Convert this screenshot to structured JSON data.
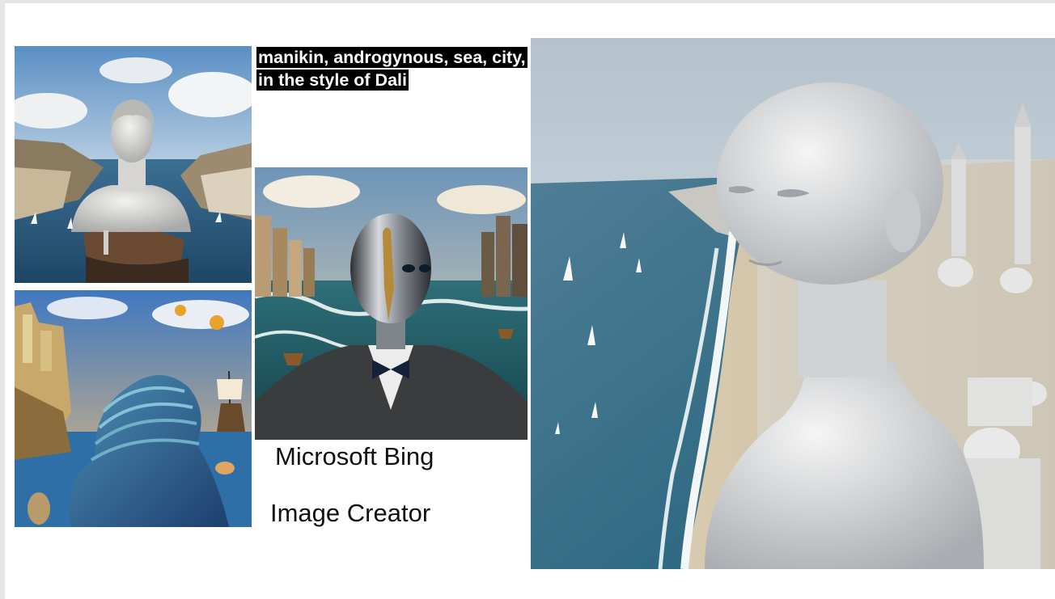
{
  "prompt_text": "manikin, androgynous, sea, city, in the style of Dali",
  "captions": {
    "line1": "Microsoft Bing",
    "line2": "Image Creator"
  }
}
